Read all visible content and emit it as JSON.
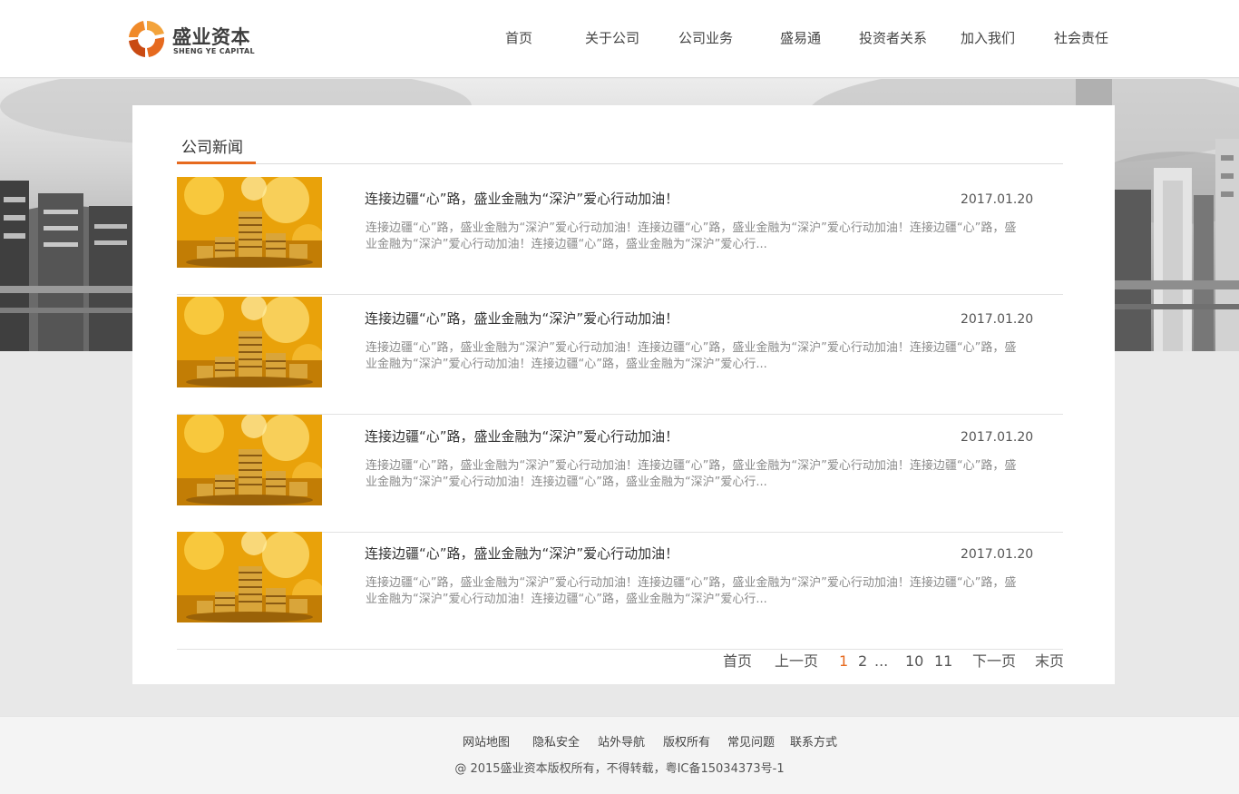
{
  "brand": {
    "name_cn": "盛业资本",
    "name_en": "SHENG YE CAPITAL",
    "colors": {
      "orange": "#e66a1f",
      "orange_light": "#f3a33b",
      "gold": "#f0b400"
    }
  },
  "nav": {
    "items": [
      "首页",
      "关于公司",
      "公司业务",
      "盛易通",
      "投资者关系",
      "加入我们",
      "社会责任"
    ]
  },
  "section": {
    "title": "公司新闻",
    "accent_color": "#e66a1f"
  },
  "news": [
    {
      "title": "连接边疆“心”路，盛业金融为“深沪”爱心行动加油！",
      "date": "2017.01.20",
      "summary": "连接边疆“心”路，盛业金融为“深沪”爱心行动加油！连接边疆“心”路，盛业金融为“深沪”爱心行动加油！连接边疆“心”路，盛业金融为“深沪”爱心行动加油！连接边疆“心”路，盛业金融为“深沪”爱心行...",
      "image": "gold-coins-image"
    },
    {
      "title": "连接边疆“心”路，盛业金融为“深沪”爱心行动加油！",
      "date": "2017.01.20",
      "summary": "连接边疆“心”路，盛业金融为“深沪”爱心行动加油！连接边疆“心”路，盛业金融为“深沪”爱心行动加油！连接边疆“心”路，盛业金融为“深沪”爱心行动加油！连接边疆“心”路，盛业金融为“深沪”爱心行...",
      "image": "gold-coins-image"
    },
    {
      "title": "连接边疆“心”路，盛业金融为“深沪”爱心行动加油！",
      "date": "2017.01.20",
      "summary": "连接边疆“心”路，盛业金融为“深沪”爱心行动加油！连接边疆“心”路，盛业金融为“深沪”爱心行动加油！连接边疆“心”路，盛业金融为“深沪”爱心行动加油！连接边疆“心”路，盛业金融为“深沪”爱心行...",
      "image": "gold-coins-image"
    },
    {
      "title": "连接边疆“心”路，盛业金融为“深沪”爱心行动加油！",
      "date": "2017.01.20",
      "summary": "连接边疆“心”路，盛业金融为“深沪”爱心行动加油！连接边疆“心”路，盛业金融为“深沪”爱心行动加油！连接边疆“心”路，盛业金融为“深沪”爱心行动加油！连接边疆“心”路，盛业金融为“深沪”爱心行...",
      "image": "gold-coins-image"
    }
  ],
  "pagination": {
    "first": "首页",
    "prev": "上一页",
    "current": "1",
    "page_2": "2",
    "ellipsis": "...",
    "page_10": "10",
    "page_11": "11",
    "next": "下一页",
    "last": "末页"
  },
  "footer": {
    "links": [
      "网站地图",
      "隐私安全",
      "站外导航",
      "版权所有",
      "常见问题",
      "联系方式"
    ],
    "copyright": "@ 2015盛业资本版权所有，不得转载，粤IC备15034373号-1"
  },
  "banner": {
    "image": "city-skyline-background"
  }
}
